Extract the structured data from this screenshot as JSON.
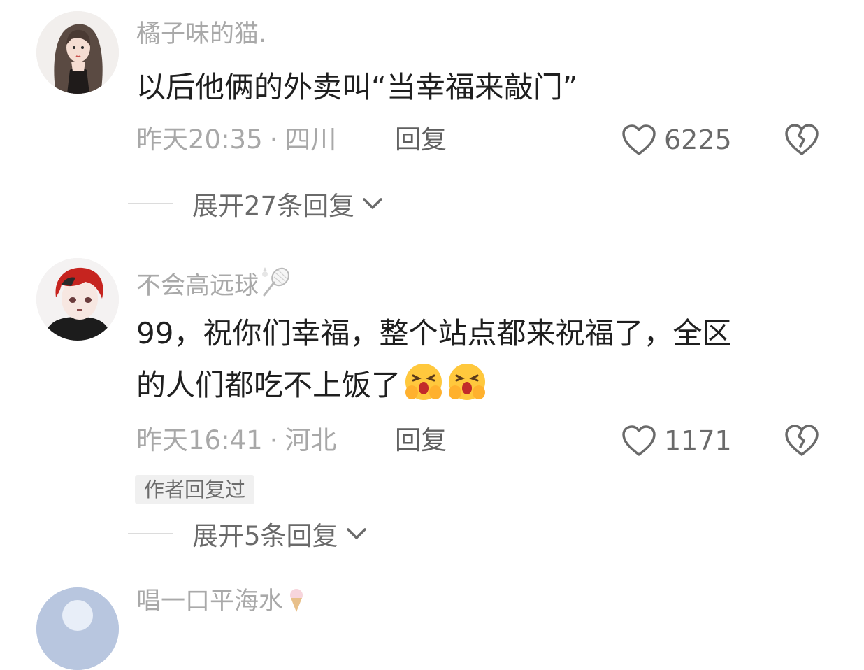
{
  "comments": [
    {
      "username": "橘子味的猫.",
      "content": "以后他俩的外卖叫“当幸福来敲门”",
      "time": "昨天20:35",
      "separator": "·",
      "location": "四川",
      "reply_label": "回复",
      "likes": "6225",
      "expand_label": "展开27条回复"
    },
    {
      "username": "不会高远球",
      "username_icon": "badminton-racket-icon",
      "content_line1": "99，祝你们幸福，整个站点都来祝福了，全区",
      "content_line2": "的人们都吃不上饭了",
      "content_emoji": "crying-laughing-emoji",
      "time": "昨天16:41",
      "separator": "·",
      "location": "河北",
      "reply_label": "回复",
      "likes": "1171",
      "author_badge": "作者回复过",
      "expand_label": "展开5条回复"
    },
    {
      "username": "唱一口平海水",
      "username_icon": "ice-cream-icon"
    }
  ],
  "colors": {
    "username": "#a9a9a9",
    "content": "#1f1f1f",
    "meta": "#a8a8a8",
    "icon": "#6a6a6a",
    "badge_bg": "#f0f0f0"
  }
}
